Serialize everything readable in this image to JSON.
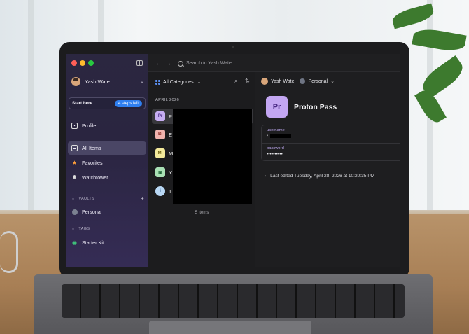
{
  "app": {
    "sidebar": {
      "user_name": "Yash Wate",
      "start_here": {
        "label": "Start here",
        "badge": "4 steps left"
      },
      "items": [
        {
          "label": "Profile",
          "icon": "profile-icon"
        },
        {
          "label": "All Items",
          "icon": "all-items-icon",
          "active": true
        },
        {
          "label": "Favorites",
          "icon": "star-icon"
        },
        {
          "label": "Watchtower",
          "icon": "watchtower-icon"
        }
      ],
      "vaults_header": "VAULTS",
      "vault": "Personal",
      "tags_header": "TAGS",
      "tag": "Starter Kit"
    },
    "search": {
      "placeholder": "Search in Yash Wate"
    },
    "list": {
      "filter_label": "All Categories",
      "date_header": "APRIL 2026",
      "items": [
        {
          "badge": "Pr",
          "title": "P",
          "badge_color": "#c7aef2"
        },
        {
          "badge": "Bi",
          "title": "E",
          "badge_color": "#f1b3ae"
        },
        {
          "badge": "Mi",
          "title": "M",
          "badge_color": "#f3e99b"
        },
        {
          "badge": "",
          "title": "Y",
          "badge_color": "#a9e0b4"
        },
        {
          "badge": "i",
          "title": "1",
          "badge_color": "#b9d8f5"
        }
      ],
      "count_label": "5 Items"
    },
    "detail": {
      "owner": "Yash Wate",
      "vault": "Personal",
      "item_badge": "Pr",
      "item_title": "Proton Pass",
      "username_label": "username",
      "password_label": "password",
      "password_value": "••••••••••",
      "last_edited": "Last edited Tuesday, April 28, 2026 at 10:20:35 PM"
    },
    "colors": {
      "accent": "#2f7ff0",
      "sidebar_bg": "#2b2740",
      "item_purple": "#c3a6f2"
    }
  }
}
